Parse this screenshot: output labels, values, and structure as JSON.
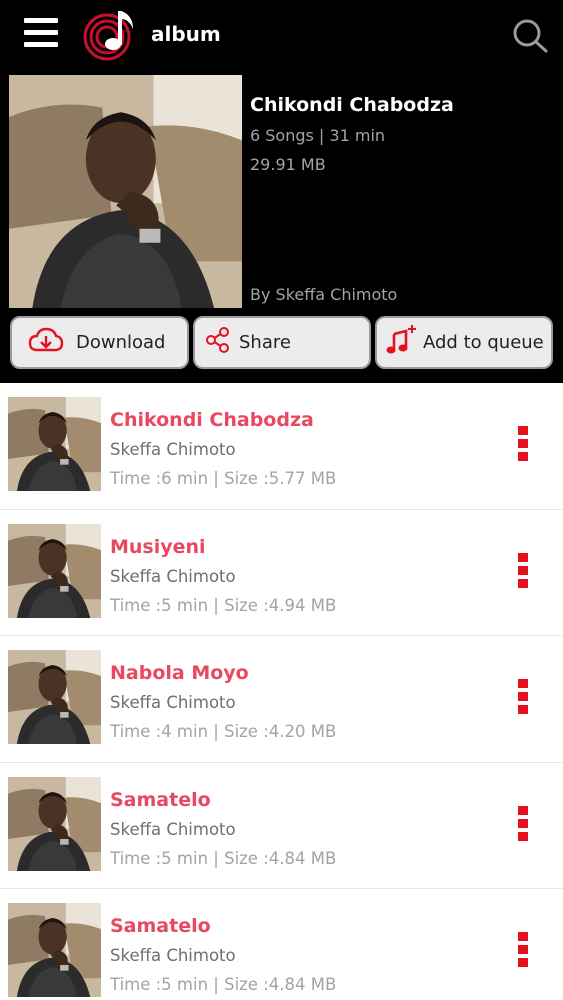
{
  "header": {
    "title": "album",
    "accent": "#e4121e"
  },
  "album": {
    "title": "Chikondi Chabodza",
    "songs_meta": "6 Songs | 31 min",
    "size": "29.91 MB",
    "artist": "By Skeffa Chimoto"
  },
  "actions": {
    "download_label": "Download",
    "share_label": "Share",
    "queue_label": "Add to queue"
  },
  "icons": [
    "menu-icon",
    "music-note-logo-icon",
    "search-icon",
    "cloud-download-icon",
    "share-icon",
    "add-to-queue-icon",
    "more-vertical-icon"
  ],
  "songs": [
    {
      "title": "Chikondi Chabodza",
      "artist": "Skeffa Chimoto",
      "meta": "Time :6 min | Size :5.77 MB"
    },
    {
      "title": "Musiyeni",
      "artist": "Skeffa Chimoto",
      "meta": "Time :5 min | Size :4.94 MB"
    },
    {
      "title": "Nabola Moyo",
      "artist": "Skeffa Chimoto",
      "meta": "Time :4 min | Size :4.20 MB"
    },
    {
      "title": "Samatelo",
      "artist": "Skeffa Chimoto",
      "meta": "Time :5 min | Size :4.84 MB"
    },
    {
      "title": "Samatelo",
      "artist": "Skeffa Chimoto",
      "meta": "Time :5 min | Size :4.84 MB"
    }
  ]
}
